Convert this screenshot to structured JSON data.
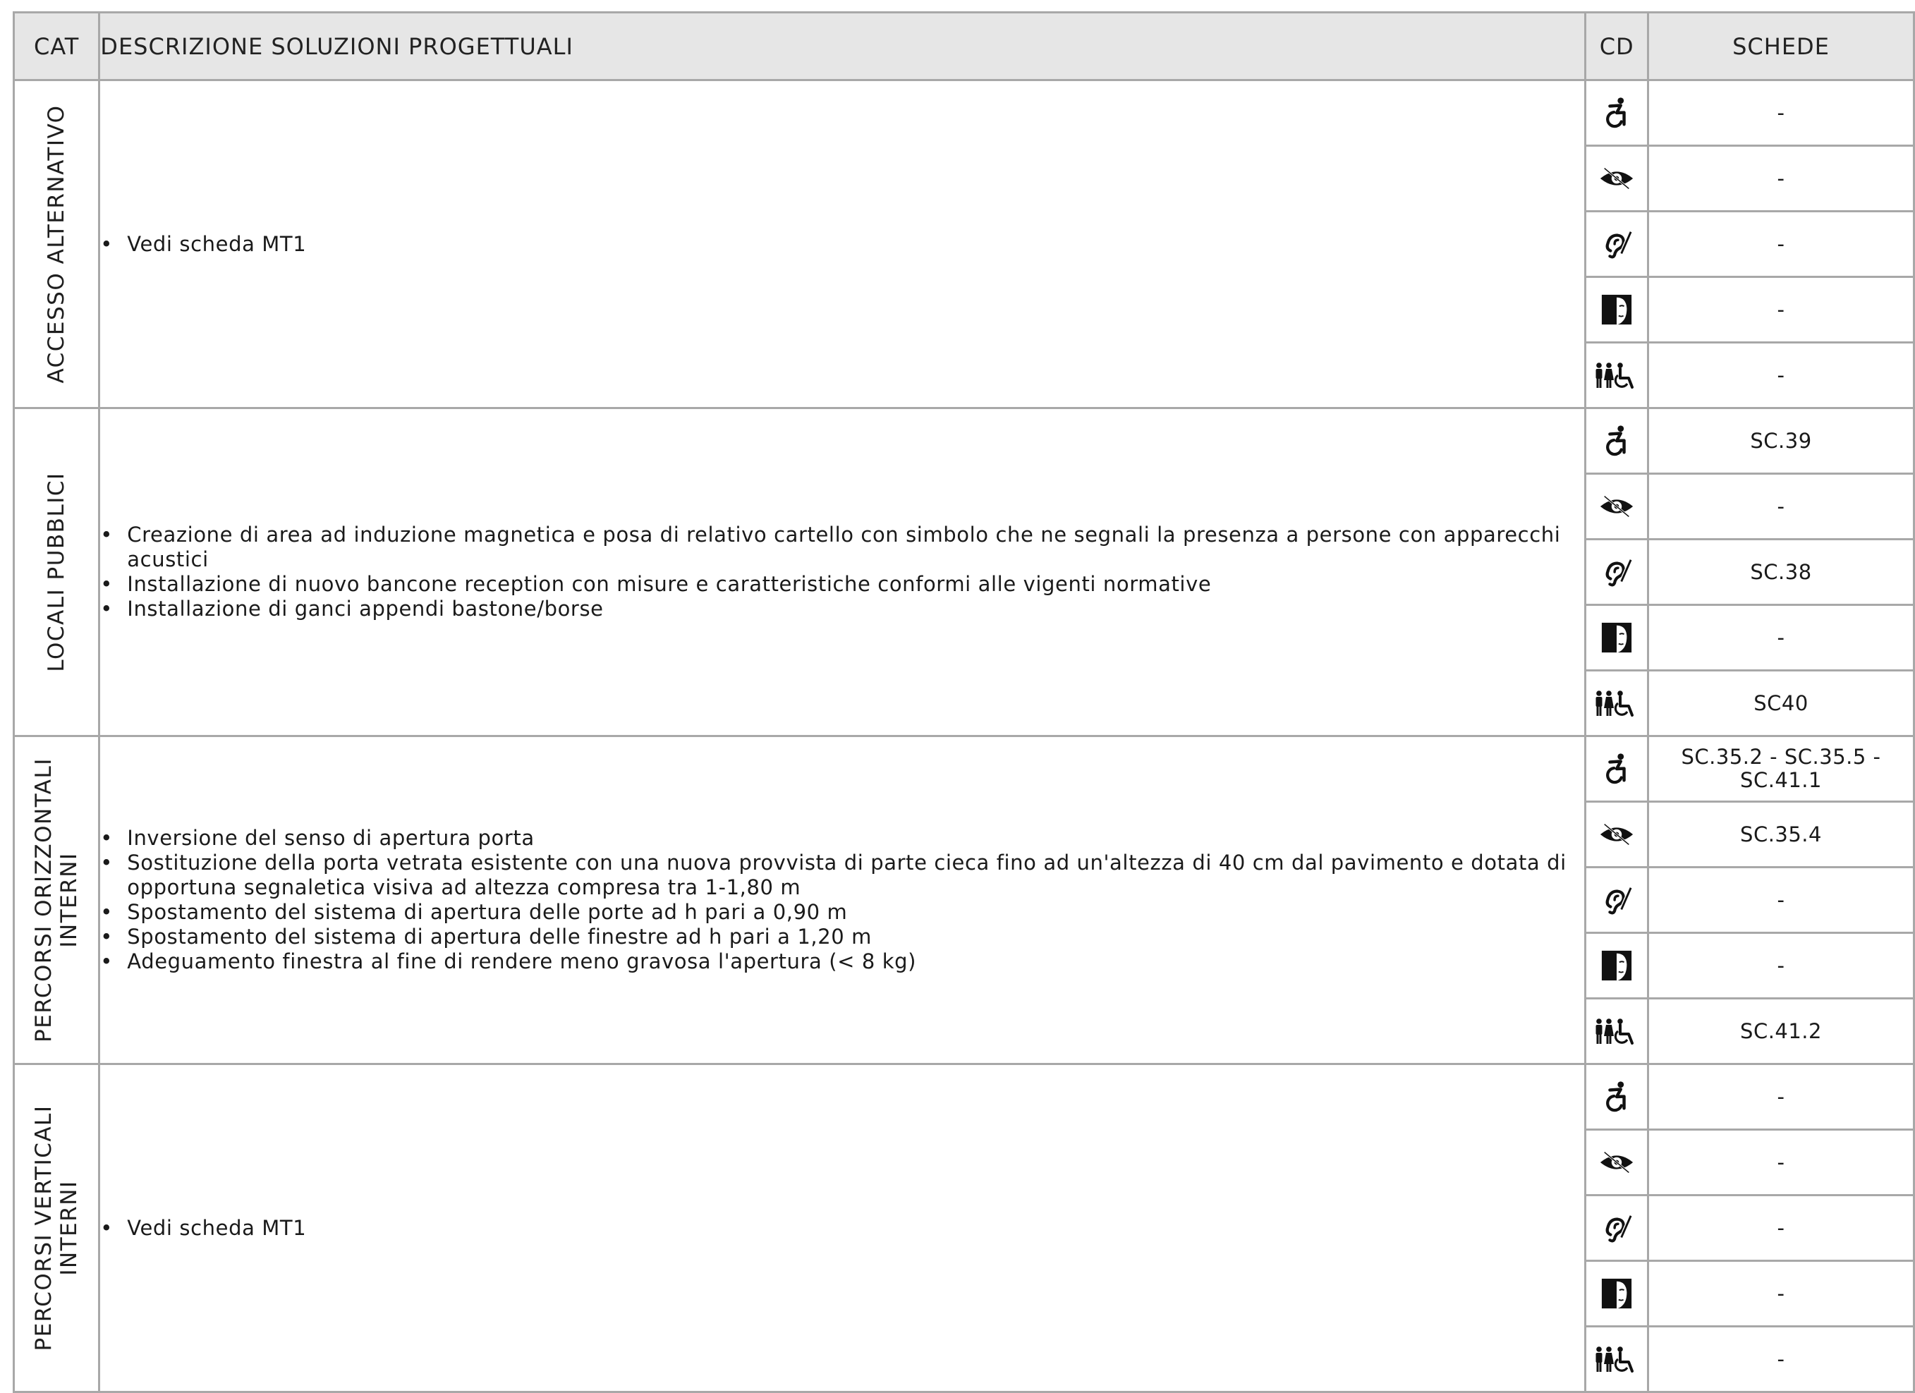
{
  "header": {
    "cat": "CAT",
    "description": "DESCRIZIONE SOLUZIONI PROGETTUALI",
    "cd": "CD",
    "schede": "SCHEDE"
  },
  "cd_icons": [
    "wheelchair-motor-icon",
    "visual-impairment-eye-icon",
    "hearing-impairment-ear-icon",
    "cognitive-face-icon",
    "family-wheelchair-icon"
  ],
  "sections": [
    {
      "category": "ACCESSO ALTERNATIVO",
      "items": [
        "Vedi scheda MT1"
      ],
      "schede": [
        "-",
        "-",
        "-",
        "-",
        "-"
      ]
    },
    {
      "category": "LOCALI PUBBLICI",
      "items": [
        "Creazione di area ad induzione magnetica e posa di relativo cartello con simbolo che ne segnali la presenza a persone con apparecchi acustici",
        "Installazione di nuovo bancone reception con misure e caratteristiche conformi alle vigenti normative",
        "Installazione di ganci appendi bastone/borse"
      ],
      "schede": [
        "SC.39",
        "-",
        "SC.38",
        "-",
        "SC40"
      ]
    },
    {
      "category": "PERCORSI ORIZZONTALI INTERNI",
      "items": [
        "Inversione del senso di apertura porta",
        "Sostituzione della porta vetrata esistente con una nuova provvista di parte cieca fino ad un'altezza di 40 cm dal pavimento e dotata di opportuna segnaletica visiva ad altezza compresa tra 1-1,80 m",
        "Spostamento del sistema di apertura delle porte ad h pari a 0,90 m",
        "Spostamento del sistema di apertura delle finestre ad h pari a 1,20 m",
        "Adeguamento finestra al fine di rendere meno gravosa l'apertura (< 8 kg)"
      ],
      "schede": [
        "SC.35.2 - SC.35.5 - SC.41.1",
        "SC.35.4",
        "-",
        "-",
        "SC.41.2"
      ]
    },
    {
      "category": "PERCORSI VERTICALI INTERNI",
      "items": [
        "Vedi scheda MT1"
      ],
      "schede": [
        "-",
        "-",
        "-",
        "-",
        "-"
      ]
    }
  ]
}
